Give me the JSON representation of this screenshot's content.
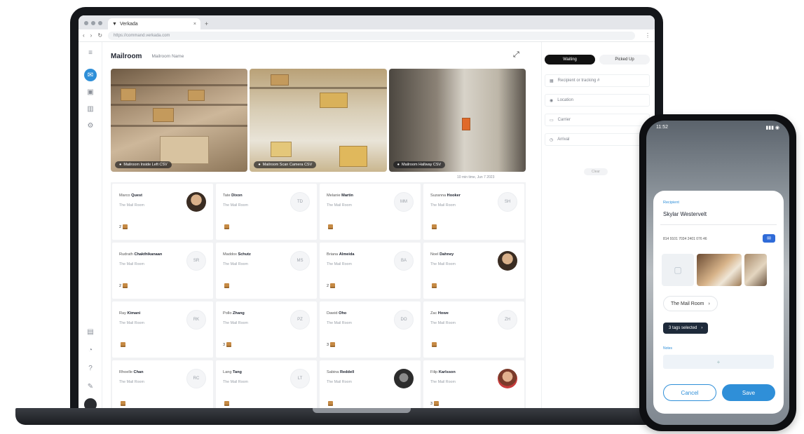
{
  "browser": {
    "tab_title": "Verkada",
    "tab_close": "×",
    "new_tab": "+",
    "url": "https://command.verkada.com",
    "nav_back": "‹",
    "nav_forward": "›",
    "reload": "↻",
    "menu": "⋮"
  },
  "header": {
    "title": "Mailroom",
    "breadcrumb": "Mailroom Name"
  },
  "cameras": [
    {
      "label": "Mailroom Inside Left CSV"
    },
    {
      "label": "Mailroom Scan Camera CSV"
    },
    {
      "label": "Mailroom Hallway CSV"
    }
  ],
  "timestamp": "10 min time, Jun 7 2023",
  "recipients": [
    {
      "first": "Marco",
      "last": "Quest",
      "location": "The Mail Room",
      "initials": "",
      "count": "2",
      "avatar": "photo"
    },
    {
      "first": "Tate",
      "last": "Dixon",
      "location": "The Mail Room",
      "initials": "TD",
      "count": "",
      "avatar": "initials"
    },
    {
      "first": "Melanie",
      "last": "Martin",
      "location": "The Mail Room",
      "initials": "MM",
      "count": "",
      "avatar": "initials"
    },
    {
      "first": "Suzanna",
      "last": "Hooker",
      "location": "The Mail Room",
      "initials": "SH",
      "count": "",
      "avatar": "initials"
    },
    {
      "first": "Rudrath",
      "last": "Chakthikanaan",
      "location": "The Mail Room",
      "initials": "SR",
      "count": "2",
      "avatar": "initials"
    },
    {
      "first": "Maddox",
      "last": "Schutz",
      "location": "The Mail Room",
      "initials": "MS",
      "count": "",
      "avatar": "initials"
    },
    {
      "first": "Briana",
      "last": "Almeida",
      "location": "The Mail Room",
      "initials": "BA",
      "count": "2",
      "avatar": "initials"
    },
    {
      "first": "Noel",
      "last": "Dahney",
      "location": "The Mail Room",
      "initials": "",
      "count": "",
      "avatar": "photo"
    },
    {
      "first": "Ray",
      "last": "Kimani",
      "location": "The Mail Room",
      "initials": "RK",
      "count": "",
      "avatar": "initials"
    },
    {
      "first": "Pollo",
      "last": "Zhang",
      "location": "The Mail Room",
      "initials": "PZ",
      "count": "3",
      "avatar": "initials"
    },
    {
      "first": "Dawid",
      "last": "Oho",
      "location": "The Mail Room",
      "initials": "DO",
      "count": "3",
      "avatar": "initials"
    },
    {
      "first": "Zac",
      "last": "Howe",
      "location": "The Mail Room",
      "initials": "ZH",
      "count": "",
      "avatar": "initials"
    },
    {
      "first": "Rhoelle",
      "last": "Chan",
      "location": "The Mail Room",
      "initials": "RC",
      "count": "",
      "avatar": "initials"
    },
    {
      "first": "Lang",
      "last": "Tang",
      "location": "The Mail Room",
      "initials": "LT",
      "count": "",
      "avatar": "initials"
    },
    {
      "first": "Sabina",
      "last": "Reddell",
      "location": "The Mail Room",
      "initials": "",
      "count": "",
      "avatar": "photo-dark"
    },
    {
      "first": "Filip",
      "last": "Karlsson",
      "location": "The Mail Room",
      "initials": "",
      "count": "3",
      "avatar": "photo-red"
    }
  ],
  "panel": {
    "tabs": [
      "Waiting",
      "Picked Up"
    ],
    "filters": [
      {
        "icon": "calendar-icon",
        "label": "Recipient or tracking #"
      },
      {
        "icon": "pin-icon",
        "label": "Location"
      },
      {
        "icon": "truck-icon",
        "label": "Carrier"
      },
      {
        "icon": "clock-icon",
        "label": "Arrival"
      }
    ],
    "more": "Clear"
  },
  "phone": {
    "time": "11:52",
    "signal": "▮▮▮ ◉",
    "recipient_label": "Recipient",
    "recipient_name": "Skylar Westervelt",
    "tracking": "814 9101 7034 2401 076 46",
    "location": "The Mail Room",
    "tags": "3 tags selected",
    "notes_label": "Notes",
    "notes_add": "+",
    "cancel": "Cancel",
    "save": "Save"
  },
  "colors": {
    "accent": "#2f8fd8",
    "dark": "#111111"
  }
}
